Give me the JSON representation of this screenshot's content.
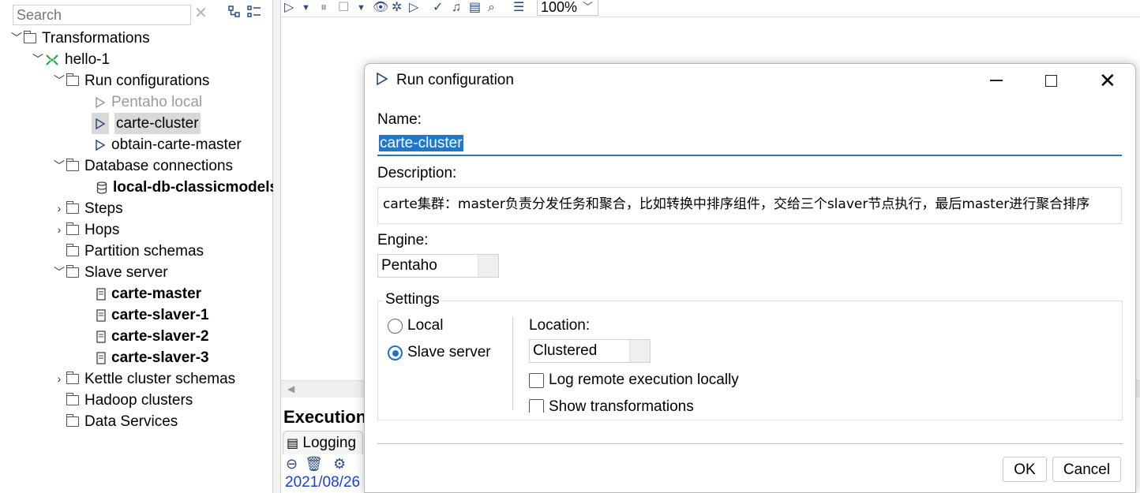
{
  "search": {
    "placeholder": "Search"
  },
  "tree": {
    "transformations": "Transformations",
    "hello": "hello-1",
    "run_configurations": "Run configurations",
    "rc_pentaho_local": "Pentaho local",
    "rc_carte_cluster": "carte-cluster",
    "rc_obtain_carte_master": "obtain-carte-master",
    "database_connections": "Database connections",
    "db_local": "local-db-classicmodels",
    "steps": "Steps",
    "hops": "Hops",
    "partition_schemas": "Partition schemas",
    "slave_server": "Slave server",
    "ss_master": "carte-master",
    "ss_slaver1": "carte-slaver-1",
    "ss_slaver2": "carte-slaver-2",
    "ss_slaver3": "carte-slaver-3",
    "kettle_cluster_schemas": "Kettle cluster schemas",
    "hadoop_clusters": "Hadoop clusters",
    "data_services": "Data Services"
  },
  "toolbar": {
    "zoom": "100%"
  },
  "bottom": {
    "execution_title": "Execution",
    "logging_tab": "Logging",
    "log_line": "2021/08/26"
  },
  "dialog": {
    "title": "Run configuration",
    "name_label": "Name:",
    "name_value": "carte-cluster",
    "description_label": "Description:",
    "description_value": "carte集群：master负责分发任务和聚合，比如转换中排序组件，交给三个slaver节点执行，最后master进行聚合排序",
    "engine_label": "Engine:",
    "engine_value": "Pentaho",
    "settings_label": "Settings",
    "radio_local": "Local",
    "radio_slave": "Slave server",
    "location_label": "Location:",
    "location_value": "Clustered",
    "check_log_remote": "Log remote execution locally",
    "check_show_transformations": "Show transformations",
    "ok": "OK",
    "cancel": "Cancel"
  },
  "colors": {
    "accent": "#1f78c8",
    "selection": "#d9d9d9",
    "toolbar_icon": "#2b4c7e"
  }
}
